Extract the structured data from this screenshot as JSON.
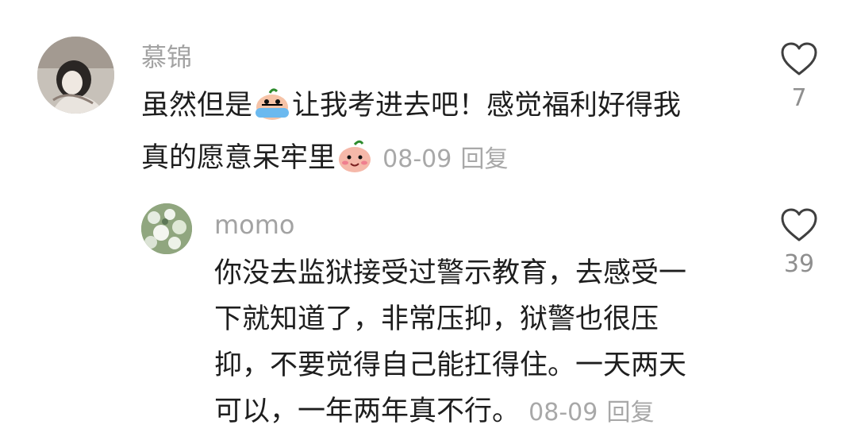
{
  "comments": [
    {
      "username": "慕锦",
      "text_parts": [
        "虽然但是",
        "让我考进去吧！感觉福利好得我",
        "真的愿意呆牢里"
      ],
      "emojis": [
        "crying-emoji",
        "smiling-peach-emoji"
      ],
      "date": "08-09",
      "reply_label": "回复",
      "likes": "7",
      "replies": [
        {
          "username": "momo",
          "lines": [
            "你没去监狱接受过警示教育，去感受一",
            "下就知道了，非常压抑，狱警也很压",
            "抑，不要觉得自己能扛得住。一天两天",
            "可以，一年两年真不行。"
          ],
          "date": "08-09",
          "reply_label": "回复",
          "likes": "39"
        }
      ]
    }
  ],
  "icons": {
    "like": "heart-outline-icon"
  },
  "colors": {
    "username": "#a3a3a3",
    "text": "#1e1e1e",
    "meta": "#a8a8a8",
    "like_count": "#8f8f8f"
  }
}
